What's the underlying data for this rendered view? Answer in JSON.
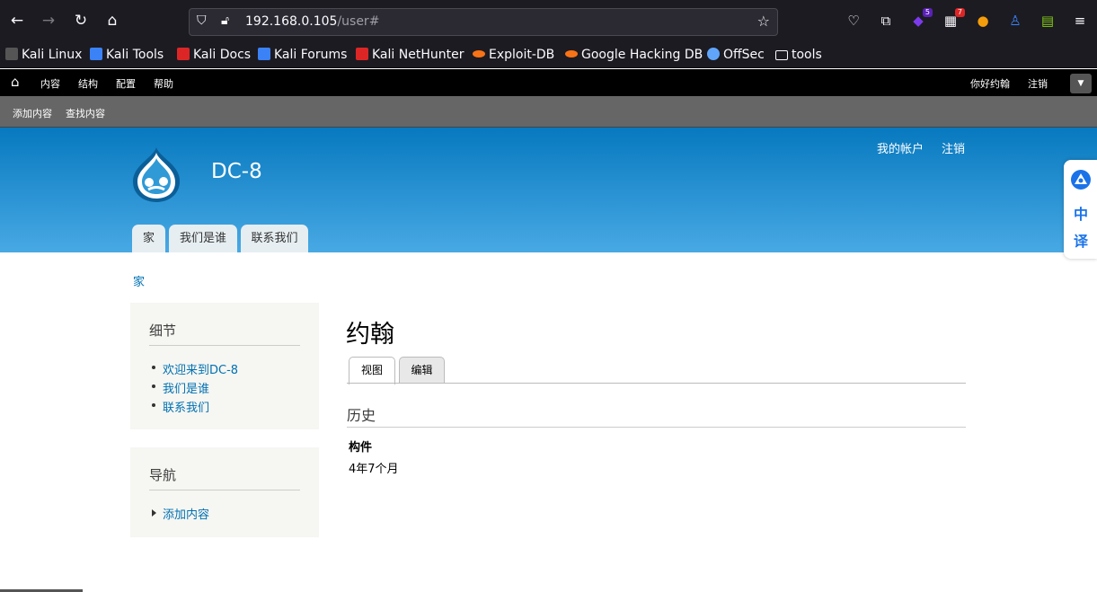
{
  "browser": {
    "url_host": "192.168.0.105",
    "url_path": "/user#",
    "extension_badges": [
      "5",
      "7"
    ]
  },
  "bookmarks": [
    {
      "label": "Kali Linux",
      "icon": "kali-dragon-icon",
      "color": "#8a8a8a"
    },
    {
      "label": "Kali Tools",
      "icon": "kali-tools-icon",
      "color": "#3b82f6"
    },
    {
      "label": "Kali Docs",
      "icon": "kali-docs-icon",
      "color": "#dc2626"
    },
    {
      "label": "Kali Forums",
      "icon": "kali-forums-icon",
      "color": "#3b82f6"
    },
    {
      "label": "Kali NetHunter",
      "icon": "nethunter-icon",
      "color": "#dc2626"
    },
    {
      "label": "Exploit-DB",
      "icon": "exploit-db-icon",
      "color": "#f97316"
    },
    {
      "label": "Google Hacking DB",
      "icon": "ghdb-icon",
      "color": "#f97316"
    },
    {
      "label": "OffSec",
      "icon": "offsec-icon",
      "color": "#60a5fa"
    },
    {
      "label": "tools",
      "icon": "folder-icon",
      "color": "#fbfbfe"
    }
  ],
  "toolbar": {
    "menu": [
      "内容",
      "结构",
      "配置",
      "帮助"
    ],
    "greeting": "你好约翰",
    "logout": "注销",
    "shortcuts": [
      "添加内容",
      "查找内容"
    ]
  },
  "header": {
    "site_name": "DC-8",
    "secondary_menu": [
      "我的帐户",
      "注销"
    ],
    "main_menu": [
      "家",
      "我们是谁",
      "联系我们"
    ]
  },
  "translate_widget": [
    "中",
    "译"
  ],
  "breadcrumb": "家",
  "sidebar": {
    "details": {
      "title": "细节",
      "links": [
        "欢迎来到DC-8",
        "我们是谁",
        "联系我们"
      ]
    },
    "navigation": {
      "title": "导航",
      "links": [
        "添加内容"
      ]
    }
  },
  "main": {
    "title": "约翰",
    "tabs": [
      "视图",
      "编辑"
    ],
    "history_title": "历史",
    "field_label": "构件",
    "field_value": "4年7个月"
  }
}
